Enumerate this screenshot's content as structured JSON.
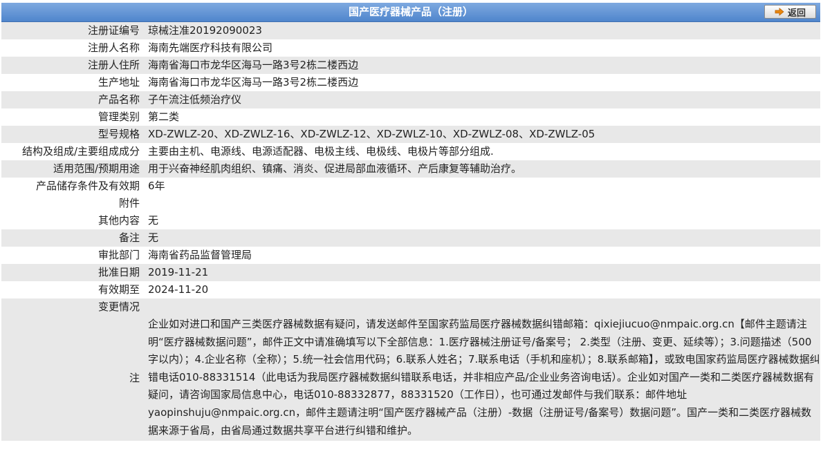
{
  "header": {
    "title": "国产医疗器械产品（注册）",
    "back_label": "返回",
    "bar_color": "#5b8ed0"
  },
  "fields": [
    {
      "label": "注册证编号",
      "value": "琼械注准20192090023"
    },
    {
      "label": "注册人名称",
      "value": "海南先端医疗科技有限公司"
    },
    {
      "label": "注册人住所",
      "value": "海南省海口市龙华区海马一路3号2栋二楼西边"
    },
    {
      "label": "生产地址",
      "value": "海南省海口市龙华区海马一路3号2栋二楼西边"
    },
    {
      "label": "产品名称",
      "value": "子午流注低频治疗仪"
    },
    {
      "label": "管理类别",
      "value": "第二类"
    },
    {
      "label": "型号规格",
      "value": "XD-ZWLZ-20、XD-ZWLZ-16、XD-ZWLZ-12、XD-ZWLZ-10、XD-ZWLZ-08、XD-ZWLZ-05"
    },
    {
      "label": "结构及组成/主要组成成分",
      "value": "主要由主机、电源线、电源适配器、电极主线、电极线、电极片等部分组成."
    },
    {
      "label": "适用范围/预期用途",
      "value": "用于兴奋神经肌肉组织、镇痛、消炎、促进局部血液循环、产后康复等辅助治疗。"
    },
    {
      "label": "产品储存条件及有效期",
      "value": "6年"
    },
    {
      "label": "附件",
      "value": ""
    },
    {
      "label": "其他内容",
      "value": "无"
    },
    {
      "label": "备注",
      "value": "无"
    },
    {
      "label": "审批部门",
      "value": "海南省药品监督管理局"
    },
    {
      "label": "批准日期",
      "value": "2019-11-21"
    },
    {
      "label": "有效期至",
      "value": "2024-11-20"
    },
    {
      "label": "变更情况",
      "value": ""
    }
  ],
  "note": {
    "label": "注",
    "text": "企业如对进口和国产三类医疗器械数据有疑问，请发送邮件至国家药监局医疗器械数据纠错邮箱：qixiejiucuo@nmpaic.org.cn【邮件主题请注明“医疗器械数据问题”，邮件正文中请准确填写以下全部信息：1.医疗器械注册证号/备案号； 2.类型（注册、变更、延续等）；3.问题描述（500字以内）；4.企业名称（全称）；5.统一社会信用代码；6.联系人姓名；7.联系电话（手机和座机）；8.联系邮箱】，或致电国家药监局医疗器械数据纠错电话010-88331514（此电话为我局医疗器械数据纠错联系电话，并非相应产品/企业业务咨询电话）。企业如对国产一类和二类医疗器械数据有疑问，请咨询国家局信息中心，电话010-88332877，88331520（工作日），也可通过发邮件与我们联系：邮件地址yaopinshuju@nmpaic.org.cn，邮件主题请注明“国产医疗器械产品（注册）-数据（注册证号/备案号）数据问题”。国产一类和二类医疗器械数据来源于省局，由省局通过数据共享平台进行纠错和维护。"
  }
}
